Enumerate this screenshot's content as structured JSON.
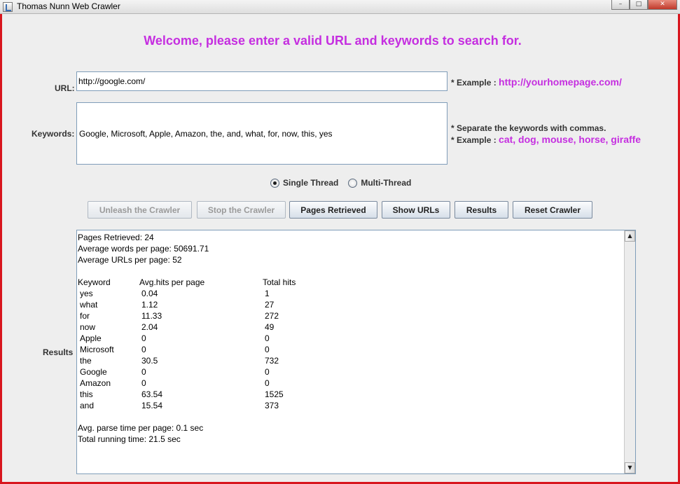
{
  "window": {
    "title": "Thomas Nunn Web Crawler",
    "controls": {
      "minimize": "–",
      "maximize": "□",
      "close": "✕"
    }
  },
  "welcome": "Welcome, please enter a valid URL and keywords to search for.",
  "url": {
    "label": "URL:",
    "value": "http://google.com/",
    "example_prefix": "* Example :",
    "example_value": "http://yourhomepage.com/"
  },
  "keywords": {
    "label": "Keywords:",
    "value": "Google, Microsoft, Apple, Amazon, the, and, what, for, now, this, yes",
    "hint": "* Separate the keywords with commas.",
    "example_prefix": "* Example :",
    "example_value": "cat, dog, mouse, horse, giraffe"
  },
  "thread_mode": {
    "options": [
      "Single Thread",
      "Multi-Thread"
    ],
    "selected": "Single Thread"
  },
  "buttons": {
    "unleash": "Unleash the Crawler",
    "stop": "Stop the Crawler",
    "pages": "Pages Retrieved",
    "show_urls": "Show URLs",
    "results": "Results",
    "reset": "Reset Crawler"
  },
  "results_label": "Results",
  "results": {
    "pages_retrieved": "Pages Retrieved: 24",
    "avg_words": "Average words per page: 50691.71",
    "avg_urls": "Average URLs per page: 52",
    "table_headers": [
      "Keyword",
      "Avg.hits per page",
      "Total hits"
    ],
    "rows": [
      {
        "keyword": "yes",
        "avg": "0.04",
        "total": "1"
      },
      {
        "keyword": "what",
        "avg": "1.12",
        "total": "27"
      },
      {
        "keyword": "for",
        "avg": "11.33",
        "total": "272"
      },
      {
        "keyword": "now",
        "avg": "2.04",
        "total": "49"
      },
      {
        "keyword": "Apple",
        "avg": "0",
        "total": "0"
      },
      {
        "keyword": "Microsoft",
        "avg": "0",
        "total": "0"
      },
      {
        "keyword": "the",
        "avg": "30.5",
        "total": "732"
      },
      {
        "keyword": "Google",
        "avg": "0",
        "total": "0"
      },
      {
        "keyword": "Amazon",
        "avg": "0",
        "total": "0"
      },
      {
        "keyword": "this",
        "avg": "63.54",
        "total": "1525"
      },
      {
        "keyword": "and",
        "avg": "15.54",
        "total": "373"
      }
    ],
    "avg_parse_time": "Avg. parse time per page: 0.1 sec",
    "total_running_time": "Total running time: 21.5 sec"
  },
  "colors": {
    "accent": "#c52ee0",
    "frame": "#d8161e"
  }
}
